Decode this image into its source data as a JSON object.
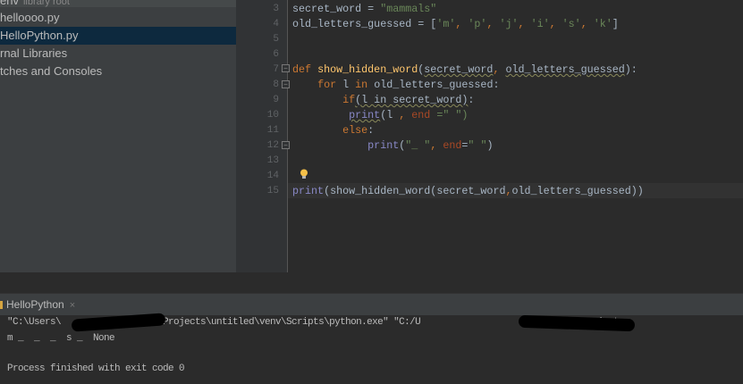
{
  "project_tree": {
    "items": [
      {
        "label": "env",
        "suffix": "library root",
        "state": "partial"
      },
      {
        "label": "helloooo.py",
        "state": "normal"
      },
      {
        "label": "HelloPython.py",
        "state": "selected"
      },
      {
        "label": "rnal Libraries",
        "state": "normal"
      },
      {
        "label": "tches and Consoles",
        "state": "normal"
      }
    ]
  },
  "editor": {
    "current_line": 15,
    "lines": [
      {
        "n": "3",
        "tokens": [
          [
            "secret_word = ",
            "pl"
          ],
          [
            "\"mammals\"",
            "st"
          ]
        ]
      },
      {
        "n": "4",
        "tokens": [
          [
            "old_letters_guessed = [",
            "pl"
          ],
          [
            "'m'",
            "st"
          ],
          [
            ", ",
            "kw"
          ],
          [
            "'p'",
            "st"
          ],
          [
            ", ",
            "kw"
          ],
          [
            "'j'",
            "st"
          ],
          [
            ", ",
            "kw"
          ],
          [
            "'i'",
            "st"
          ],
          [
            ", ",
            "kw"
          ],
          [
            "'s'",
            "st"
          ],
          [
            ", ",
            "kw"
          ],
          [
            "'k'",
            "st"
          ],
          [
            "]",
            "pl"
          ]
        ]
      },
      {
        "n": "5",
        "tokens": []
      },
      {
        "n": "6",
        "tokens": []
      },
      {
        "n": "7",
        "tokens": [
          [
            "def ",
            "kw"
          ],
          [
            "show_hidden_word",
            "fn"
          ],
          [
            "(",
            "pl"
          ],
          [
            "secret_word",
            "pl wavy"
          ],
          [
            ", ",
            "kw"
          ],
          [
            "old_letters_guessed",
            "pl wavy"
          ],
          [
            "):",
            "pl"
          ]
        ]
      },
      {
        "n": "8",
        "tokens": [
          [
            "    ",
            "pl"
          ],
          [
            "for ",
            "kw"
          ],
          [
            "l ",
            "pl"
          ],
          [
            "in ",
            "kw"
          ],
          [
            "old_letters_guessed:",
            "pl"
          ]
        ]
      },
      {
        "n": "9",
        "tokens": [
          [
            "        ",
            "pl"
          ],
          [
            "if",
            "kw"
          ],
          [
            "(l in secret_word)",
            "pl wavy"
          ],
          [
            ":",
            "pl"
          ]
        ]
      },
      {
        "n": "10",
        "tokens": [
          [
            "         ",
            "pl"
          ],
          [
            "print",
            "bi wavy"
          ],
          [
            "(l ",
            ""
          ],
          [
            ", ",
            "kw"
          ],
          [
            "end ",
            "ka"
          ],
          [
            "=\" \")",
            "st"
          ]
        ]
      },
      {
        "n": "11",
        "tokens": [
          [
            "        ",
            "pl"
          ],
          [
            "else",
            "kw"
          ],
          [
            ":",
            "pl"
          ]
        ]
      },
      {
        "n": "12",
        "tokens": [
          [
            "            ",
            "pl"
          ],
          [
            "print",
            "bi"
          ],
          [
            "(",
            "pl"
          ],
          [
            "\"_ \"",
            "st"
          ],
          [
            ", ",
            "kw"
          ],
          [
            "end",
            "ka"
          ],
          [
            "=",
            "pl"
          ],
          [
            "\" \"",
            "st"
          ],
          [
            ")",
            "pl"
          ]
        ]
      },
      {
        "n": "13",
        "tokens": []
      },
      {
        "n": "14",
        "tokens": []
      },
      {
        "n": "15",
        "tokens": [
          [
            "print",
            "bi"
          ],
          [
            "(show_hidden_word(secret_word",
            "pl"
          ],
          [
            ",",
            "kw"
          ],
          [
            "old_letters_guessed))",
            "pl"
          ]
        ]
      }
    ]
  },
  "run_panel": {
    "tab_label": "HelloPython",
    "close_icon": "×",
    "output": [
      "\"C:\\Users\\            PycharmProjects\\untitled\\venv\\Scripts\\python.exe\" \"C:/U                      /PycharmProjects",
      "m _  _  _  s _  None",
      "",
      "Process finished with exit code 0"
    ]
  }
}
